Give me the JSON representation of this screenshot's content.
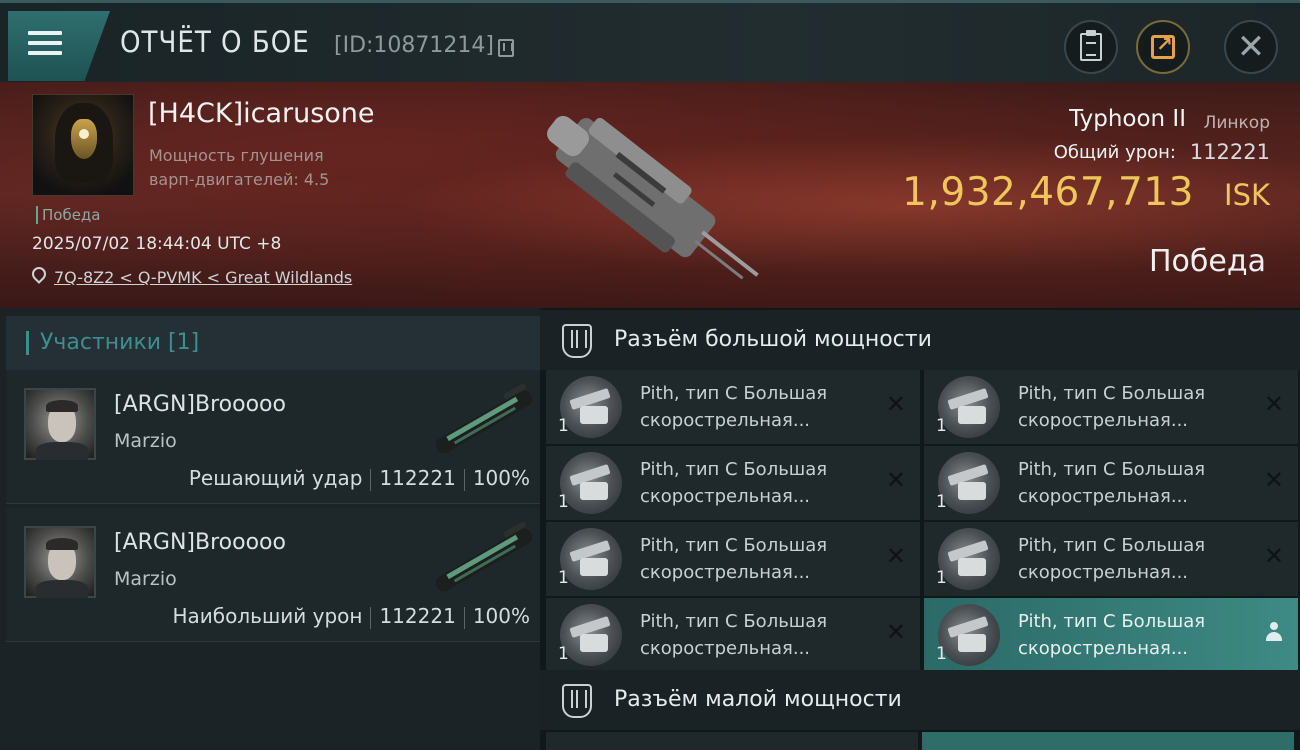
{
  "topbar": {
    "title": "ОТЧЁТ О БОЕ",
    "report_id": "[ID:10871214]"
  },
  "victim": {
    "name": "[H4CK]icarusone",
    "stat_line1": "Мощность глушения",
    "stat_line2": "варп-двигателей: 4.5",
    "tag": "Победа",
    "datetime": "2025/07/02 18:44:04 UTC +8",
    "location": "7Q-8Z2 < Q-PVMK < Great Wildlands",
    "ship_name": "Typhoon II",
    "ship_class": "Линкор",
    "damage_label": "Общий урон:",
    "damage_value": "112221",
    "isk_value": "1,932,467,713",
    "isk_unit": "ISK",
    "result": "Победа"
  },
  "participants": {
    "header": "Участники [1]",
    "cards": [
      {
        "name": "[ARGN]Brooooo",
        "corp": "Marzio",
        "role": "Решающий удар",
        "damage": "112221",
        "percent": "100%"
      },
      {
        "name": "[ARGN]Brooooo",
        "corp": "Marzio",
        "role": "Наибольший урон",
        "damage": "112221",
        "percent": "100%"
      }
    ]
  },
  "fitting": {
    "high_slot_title": "Разъём большой мощности",
    "low_slot_title": "Разъём малой мощности",
    "modules": [
      {
        "qty": "1",
        "line1": "Pith, тип C Большая",
        "line2": "скорострельная..."
      },
      {
        "qty": "1",
        "line1": "Pith, тип C Большая",
        "line2": "скорострельная..."
      },
      {
        "qty": "1",
        "line1": "Pith, тип C Большая",
        "line2": "скорострельная..."
      },
      {
        "qty": "1",
        "line1": "Pith, тип C Большая",
        "line2": "скорострельная..."
      },
      {
        "qty": "1",
        "line1": "Pith, тип C Большая",
        "line2": "скорострельная..."
      },
      {
        "qty": "1",
        "line1": "Pith, тип C Большая",
        "line2": "скорострельная..."
      },
      {
        "qty": "1",
        "line1": "Pith, тип C Большая",
        "line2": "скорострельная..."
      },
      {
        "qty": "1",
        "line1": "Pith, тип C Большая",
        "line2": "скорострельная..."
      }
    ]
  },
  "icons": {
    "menu": "menu-icon",
    "copy": "copy-icon",
    "clipboard": "clipboard-icon",
    "share": "share-icon",
    "close": "close-icon",
    "location": "location-pin-icon",
    "slot": "slot-icon",
    "remove": "close-icon",
    "user": "user-icon"
  },
  "colors": {
    "accent": "#3f8e8e",
    "isk": "#f0c55a",
    "highlight": "#3e8a84"
  }
}
